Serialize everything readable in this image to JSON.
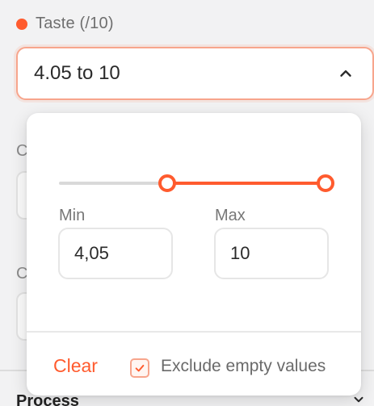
{
  "colors": {
    "accent": "#ff5b2e",
    "accent_soft": "#f7a58c"
  },
  "filter": {
    "title": "Taste (/10)",
    "range_text": "4.05 to 10",
    "range": {
      "min": 4.05,
      "max": 10,
      "scale_min": 0,
      "scale_max": 10
    }
  },
  "popover": {
    "min_label": "Min",
    "max_label": "Max",
    "min_value": "4,05",
    "max_value": "10",
    "clear_label": "Clear",
    "exclude_label": "Exclude empty values",
    "exclude_checked": true
  },
  "background": {
    "peek_label_1": "C",
    "peek_label_2": "C",
    "bottom_label": "Process"
  }
}
